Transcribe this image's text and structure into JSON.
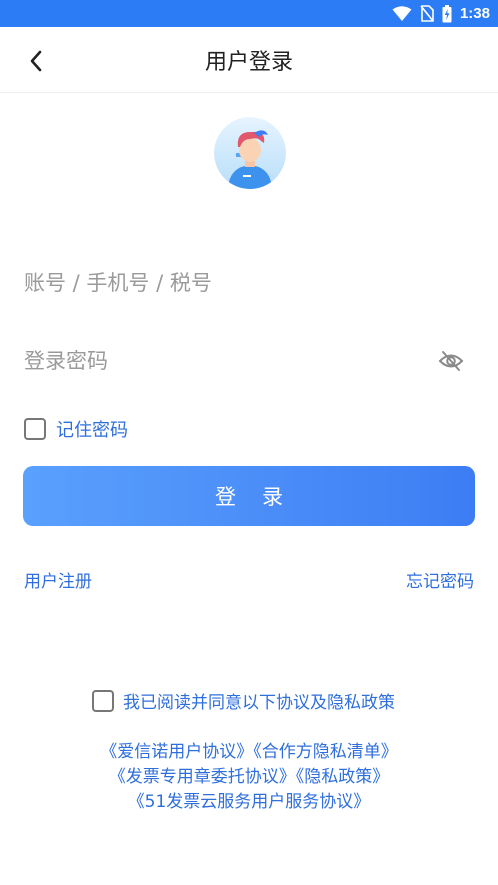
{
  "status_bar": {
    "time": "1:38",
    "background": "#2c7cf6",
    "icons": [
      "wifi-icon",
      "no-sim-icon",
      "battery-charging-icon"
    ]
  },
  "header": {
    "title": "用户登录",
    "back_icon": "chevron-left-icon"
  },
  "form": {
    "account_placeholder": "账号 / 手机号 / 税号",
    "password_placeholder": "登录密码",
    "remember_label": "记住密码",
    "remember_checked": false,
    "login_label": "登录",
    "password_toggle_icon": "eye-off-icon"
  },
  "links": {
    "register": "用户注册",
    "forgot": "忘记密码"
  },
  "agreement": {
    "checkbox_label": "我已阅读并同意以下协议及隐私政策",
    "checked": false,
    "items": [
      "《爱信诺用户协议》",
      "《合作方隐私清单》",
      "《发票专用章委托协议》",
      "《隐私政策》",
      "《51发票云服务用户服务协议》"
    ]
  },
  "colors": {
    "accent": "#2f6fdc",
    "button_start": "#5aa0fd",
    "button_end": "#3d7df4"
  }
}
